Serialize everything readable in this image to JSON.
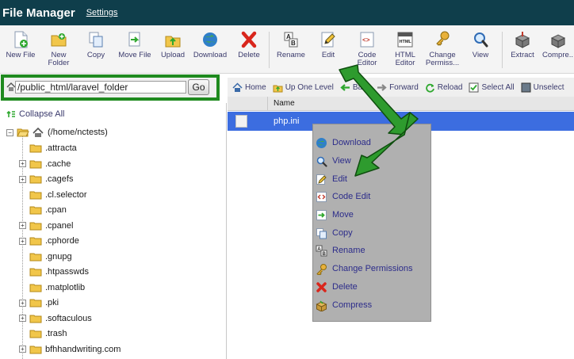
{
  "header": {
    "title": "File Manager",
    "settings_label": "Settings"
  },
  "toolbar": {
    "new_file": "New File",
    "new_folder_1": "New",
    "new_folder_2": "Folder",
    "copy": "Copy",
    "move_file": "Move File",
    "upload": "Upload",
    "download": "Download",
    "delete": "Delete",
    "rename": "Rename",
    "edit": "Edit",
    "code_editor_1": "Code",
    "code_editor_2": "Editor",
    "html_editor_1": "HTML",
    "html_editor_2": "Editor",
    "change_perm_1": "Change",
    "change_perm_2": "Permiss...",
    "view": "View",
    "extract": "Extract",
    "compress": "Compre..."
  },
  "path": {
    "value": "/public_html/laravel_folder",
    "go_label": "Go"
  },
  "navbar": {
    "home": "Home",
    "up_one_level": "Up One Level",
    "back": "Back",
    "forward": "Forward",
    "reload": "Reload",
    "select_all": "Select All",
    "unselect": "Unselect"
  },
  "tree": {
    "collapse_all": "Collapse All",
    "root": "(/home/nctests)",
    "items": [
      {
        "label": ".attracta",
        "expandable": false
      },
      {
        "label": ".cache",
        "expandable": true
      },
      {
        "label": ".cagefs",
        "expandable": true
      },
      {
        "label": ".cl.selector",
        "expandable": false
      },
      {
        "label": ".cpan",
        "expandable": false
      },
      {
        "label": ".cpanel",
        "expandable": true
      },
      {
        "label": ".cphorde",
        "expandable": true
      },
      {
        "label": ".gnupg",
        "expandable": false
      },
      {
        "label": ".htpasswds",
        "expandable": false
      },
      {
        "label": ".matplotlib",
        "expandable": false
      },
      {
        "label": ".pki",
        "expandable": true
      },
      {
        "label": ".softaculous",
        "expandable": true
      },
      {
        "label": ".trash",
        "expandable": false
      },
      {
        "label": "bfhhandwriting.com",
        "expandable": true
      }
    ]
  },
  "filelist": {
    "column_name": "Name",
    "rows": [
      {
        "name": "php.ini"
      }
    ]
  },
  "context_menu": {
    "items": [
      {
        "label": "Download",
        "icon": "globe-icon"
      },
      {
        "label": "View",
        "icon": "magnifier-icon"
      },
      {
        "label": "Edit",
        "icon": "pencil-icon"
      },
      {
        "label": "Code Edit",
        "icon": "code-icon"
      },
      {
        "label": "Move",
        "icon": "arrow-icon"
      },
      {
        "label": "Copy",
        "icon": "copy-icon"
      },
      {
        "label": "Rename",
        "icon": "rename-icon"
      },
      {
        "label": "Change Permissions",
        "icon": "key-icon"
      },
      {
        "label": "Delete",
        "icon": "x-icon"
      },
      {
        "label": "Compress",
        "icon": "box-icon"
      }
    ]
  },
  "colors": {
    "header_bg": "#0f3e4b",
    "highlight_green": "#1f8a1f",
    "selection_blue": "#3c6de0",
    "menu_bg": "#b0b0b0",
    "link_text": "#2c2c8a"
  }
}
